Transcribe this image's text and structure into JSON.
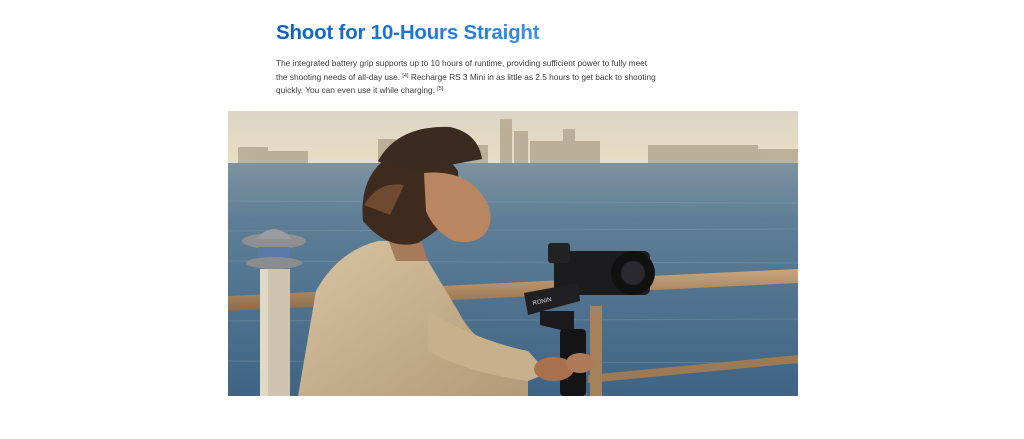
{
  "section": {
    "title": "Shoot for 10-Hours Straight",
    "description": {
      "part1": "The integrated battery grip supports up to 10 hours of runtime, providing sufficient power to fully meet the shooting needs of all-day use. ",
      "ref1": "[4]",
      "part2": " Recharge RS 3 Mini in as little as 2.5 hours to get back to shooting quickly. You can even use it while charging. ",
      "ref2": "[5]"
    }
  },
  "photo": {
    "gimbal_label": "RONIN"
  }
}
